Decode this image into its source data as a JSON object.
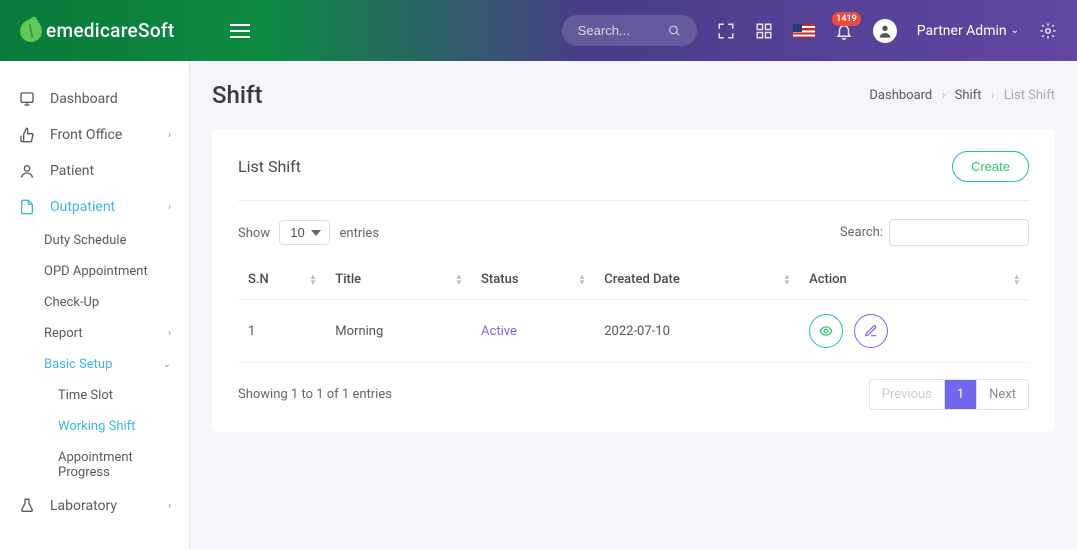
{
  "brand": "emedicareSoft",
  "topbar": {
    "search_placeholder": "Search...",
    "badge_count": "1419",
    "user_name": "Partner Admin"
  },
  "sidebar": {
    "dashboard": "Dashboard",
    "front_office": "Front Office",
    "patient": "Patient",
    "outpatient": "Outpatient",
    "out_sub": {
      "duty": "Duty Schedule",
      "opd": "OPD Appointment",
      "checkup": "Check-Up",
      "report": "Report",
      "basic": "Basic Setup",
      "basic_sub": {
        "timeslot": "Time Slot",
        "shift": "Working Shift",
        "progress": "Appointment Progress"
      }
    },
    "laboratory": "Laboratory"
  },
  "page": {
    "title": "Shift",
    "breadcrumb": {
      "dashboard": "Dashboard",
      "shift": "Shift",
      "current": "List Shift"
    },
    "card_title": "List Shift",
    "create_btn": "Create"
  },
  "table": {
    "show_label_pre": "Show",
    "show_label_post": "entries",
    "entries_option": "10",
    "search_label": "Search:",
    "columns": {
      "sn": "S.N",
      "title": "Title",
      "status": "Status",
      "created": "Created Date",
      "action": "Action"
    },
    "rows": [
      {
        "sn": "1",
        "title": "Morning",
        "status": "Active",
        "created": "2022-07-10"
      }
    ],
    "info": "Showing 1 to 1 of 1 entries",
    "pagination": {
      "prev": "Previous",
      "page": "1",
      "next": "Next"
    }
  }
}
